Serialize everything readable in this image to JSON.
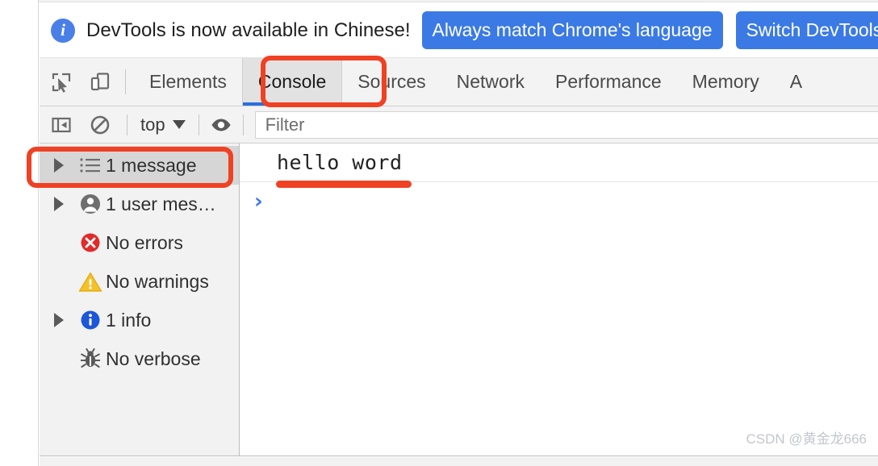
{
  "banner": {
    "icon": "info-circle-icon",
    "message": "DevTools is now available in Chinese!",
    "primary_button": "Always match Chrome's language",
    "secondary_button": "Switch DevTools to Chinese"
  },
  "tabbar": {
    "inspect_icon": "inspect-element-icon",
    "device_icon": "device-toolbar-icon",
    "tabs": [
      {
        "label": "Elements",
        "selected": false
      },
      {
        "label": "Console",
        "selected": true
      },
      {
        "label": "Sources",
        "selected": false
      },
      {
        "label": "Network",
        "selected": false
      },
      {
        "label": "Performance",
        "selected": false
      },
      {
        "label": "Memory",
        "selected": false
      },
      {
        "label": "A",
        "selected": false
      }
    ]
  },
  "filterbar": {
    "sidebar_toggle_icon": "show-console-sidebar-icon",
    "clear_icon": "clear-console-icon",
    "context_label": "top",
    "context_caret_icon": "chevron-down-icon",
    "eye_icon": "live-expression-eye-icon",
    "filter_placeholder": "Filter",
    "filter_value": ""
  },
  "sidebar": {
    "items": [
      {
        "label": "1 message",
        "icon": "list-icon",
        "expandable": true,
        "selected": true
      },
      {
        "label": "1 user mes…",
        "icon": "user-icon",
        "expandable": true,
        "selected": false
      },
      {
        "label": "No errors",
        "icon": "error-icon",
        "expandable": false,
        "selected": false
      },
      {
        "label": "No warnings",
        "icon": "warning-icon",
        "expandable": false,
        "selected": false
      },
      {
        "label": "1 info",
        "icon": "info-icon",
        "expandable": true,
        "selected": false
      },
      {
        "label": "No verbose",
        "icon": "verbose-bug-icon",
        "expandable": false,
        "selected": false
      }
    ]
  },
  "console": {
    "log_entries": [
      {
        "text": "hello word"
      }
    ],
    "prompt_caret": "›"
  },
  "watermark": {
    "text": "CSDN @黄金龙666"
  },
  "annotations": {
    "console_tab_box": "red-highlight-box",
    "message_row_box": "red-highlight-box",
    "hello_word_underline": "red-underline"
  },
  "colors": {
    "accent_blue": "#3b78e7",
    "tab_underline": "#2a6ede",
    "annotation_red": "#ef4123",
    "error_red": "#e02b2b",
    "warning_yellow": "#f5c02a",
    "info_blue": "#1c57d8"
  }
}
